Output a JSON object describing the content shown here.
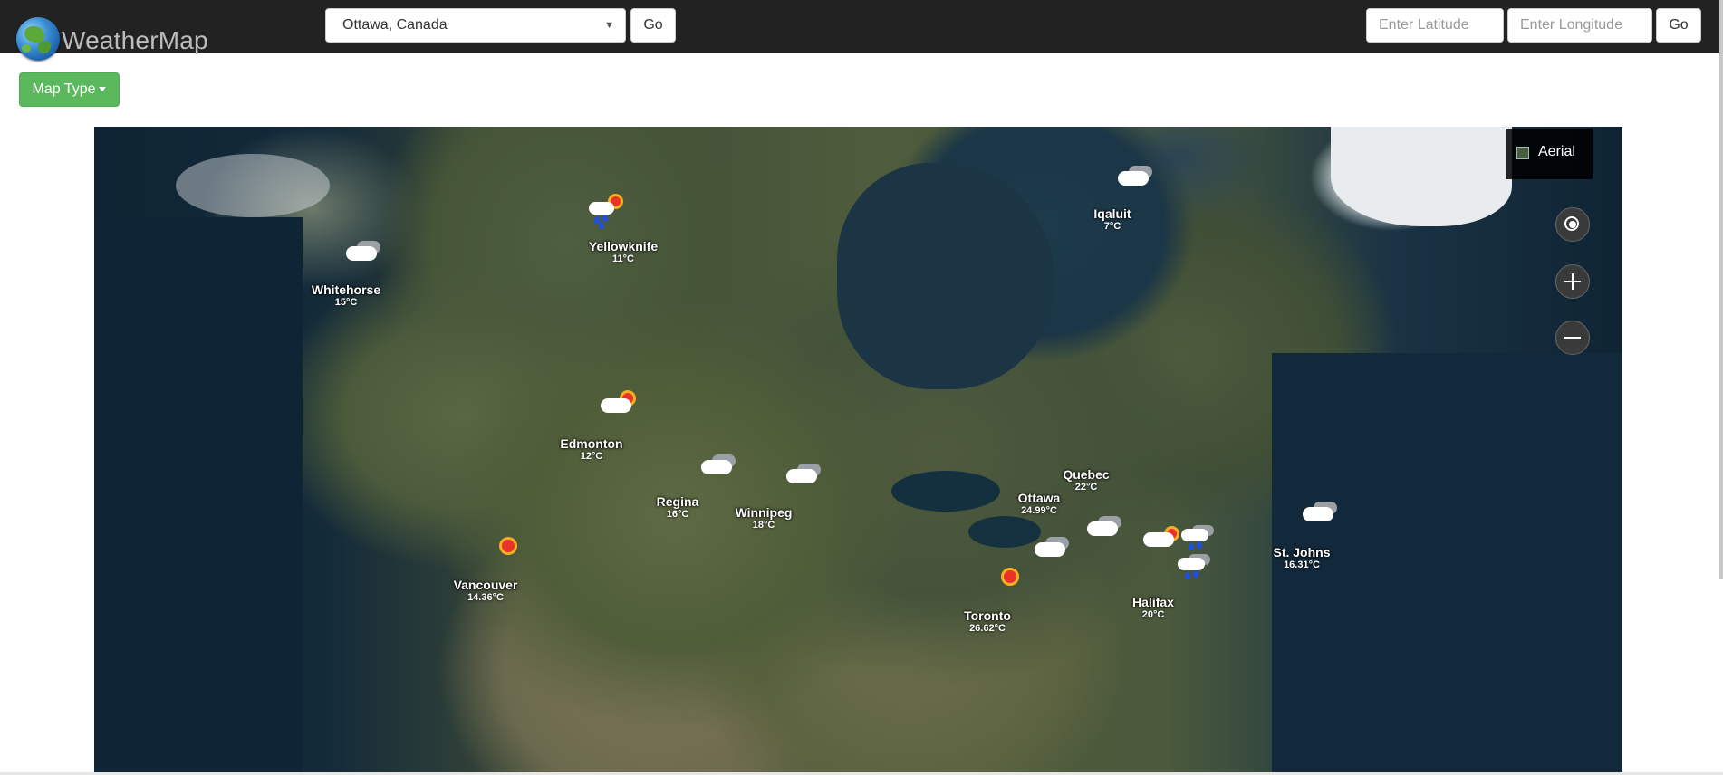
{
  "app": {
    "title": "WeatherMap"
  },
  "search": {
    "selected_city": "Ottawa, Canada",
    "go_label": "Go"
  },
  "coords": {
    "lat_placeholder": "Enter Latitude",
    "lon_placeholder": "Enter Longitude",
    "go_label": "Go"
  },
  "map_type": {
    "label": "Map Type"
  },
  "map": {
    "style_label": "Aerial",
    "controls": [
      "locate-icon",
      "zoom-in-icon",
      "zoom-out-icon"
    ],
    "cities": [
      {
        "name": "Yellowknife",
        "temp": "11°C",
        "icon": "rain-sun"
      },
      {
        "name": "Whitehorse",
        "temp": "15°C",
        "icon": "cloudy"
      },
      {
        "name": "Iqaluit",
        "temp": "7°C",
        "icon": "cloudy"
      },
      {
        "name": "Edmonton",
        "temp": "12°C",
        "icon": "partly-sunny"
      },
      {
        "name": "Regina",
        "temp": "16°C",
        "icon": "cloudy"
      },
      {
        "name": "Winnipeg",
        "temp": "18°C",
        "icon": "cloudy"
      },
      {
        "name": "Quebec",
        "temp": "22°C",
        "icon": "cloudy"
      },
      {
        "name": "Ottawa",
        "temp": "24.99°C",
        "icon": "cloudy"
      },
      {
        "name": "Vancouver",
        "temp": "14.36°C",
        "icon": "sunny"
      },
      {
        "name": "Toronto",
        "temp": "26.62°C",
        "icon": "sunny"
      },
      {
        "name": "St. Johns",
        "temp": "16.31°C",
        "icon": "cloudy"
      },
      {
        "name": "Halifax",
        "temp": "20°C",
        "icon": "rain"
      }
    ]
  }
}
